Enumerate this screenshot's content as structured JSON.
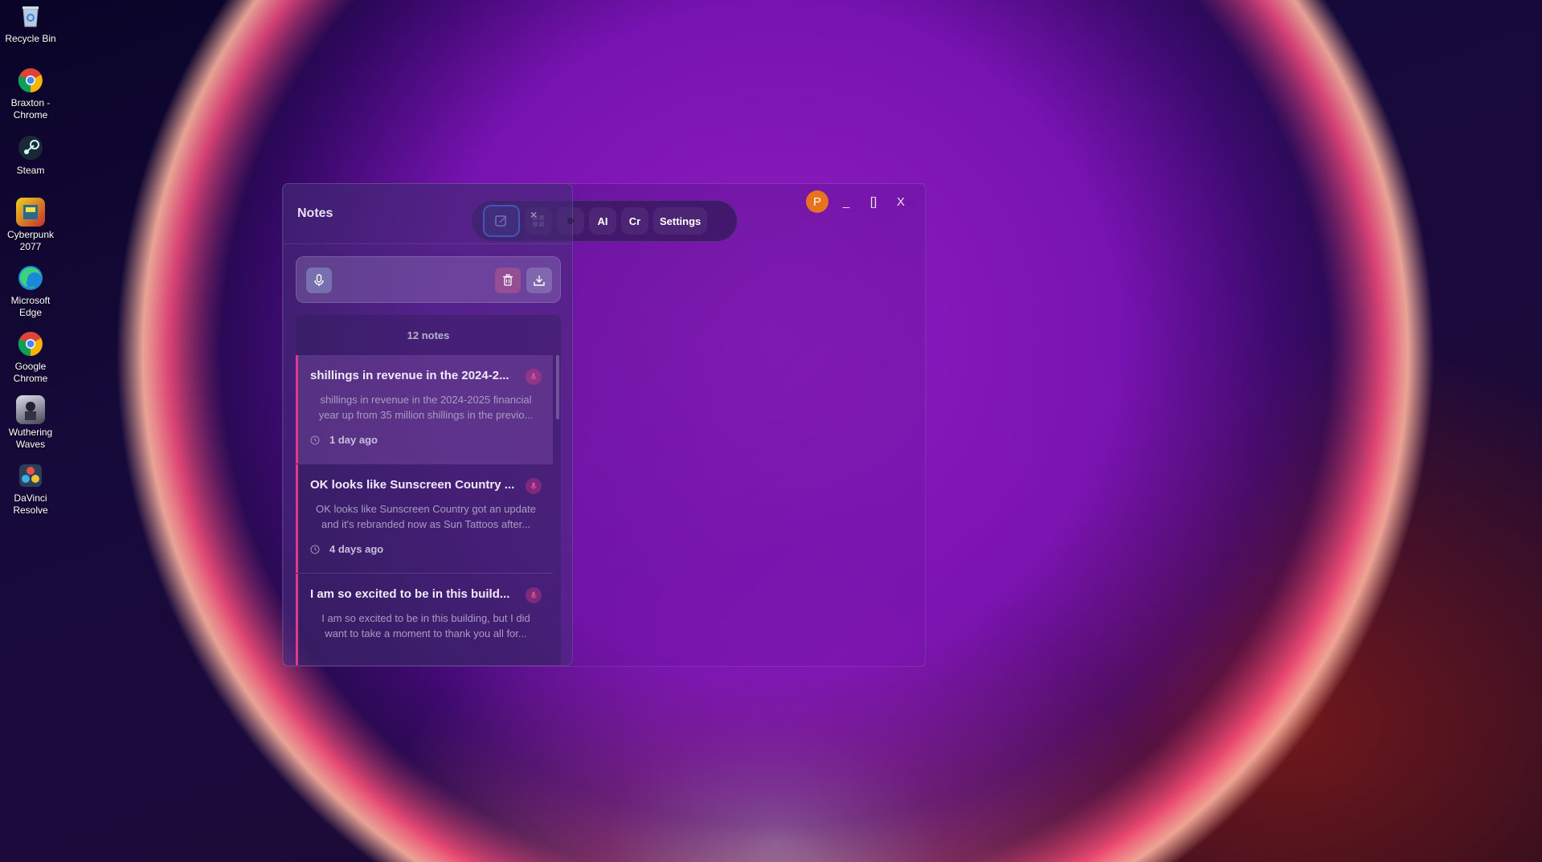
{
  "desktop": {
    "icons": [
      {
        "label": "Recycle Bin",
        "icon": "recycle-bin-icon"
      },
      {
        "label": "Braxton - Chrome",
        "icon": "chrome-icon"
      },
      {
        "label": "Steam",
        "icon": "steam-icon"
      },
      {
        "label": "Cyberpunk 2077",
        "icon": "cyberpunk-icon"
      },
      {
        "label": "Microsoft Edge",
        "icon": "edge-icon"
      },
      {
        "label": "Google Chrome",
        "icon": "chrome-icon"
      },
      {
        "label": "Wuthering Waves",
        "icon": "wuthering-waves-icon"
      },
      {
        "label": "DaVinci Resolve",
        "icon": "davinci-icon"
      }
    ]
  },
  "window": {
    "avatar_letter": "P",
    "minimize": "_",
    "maximize": "[]",
    "close": "X"
  },
  "toolbar": {
    "close_glyph": "×",
    "ai_label": "AI",
    "cr_label": "Cr",
    "settings_label": "Settings"
  },
  "notes": {
    "title": "Notes",
    "count_label": "12 notes",
    "items": [
      {
        "title": "shillings in revenue in the 2024-2...",
        "body": "shillings in revenue in the 2024-2025 financial year up from 35 million shillings in the previo...",
        "time": "1 day ago"
      },
      {
        "title": "OK looks like Sunscreen Country ...",
        "body": "OK looks like Sunscreen Country got an update and it's rebranded now as Sun Tattoos after...",
        "time": "4 days ago"
      },
      {
        "title": "I am so excited to be in this build...",
        "body": "I am so excited to be in this building, but I did want to take a moment to thank you all for...",
        "time": ""
      }
    ]
  },
  "colors": {
    "accent_pink": "#e03a8a",
    "avatar_orange": "#e8721d",
    "active_blue": "#3d8bff"
  }
}
